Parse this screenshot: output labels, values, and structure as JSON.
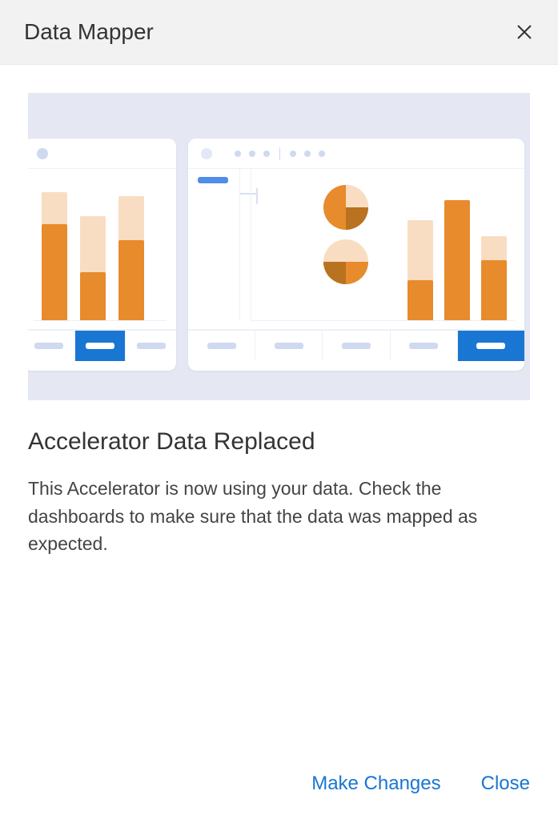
{
  "header": {
    "title": "Data Mapper"
  },
  "content": {
    "heading": "Accelerator Data Replaced",
    "body": "This Accelerator is now using your data. Check the dashboards to make sure that the data was mapped as expected."
  },
  "footer": {
    "make_changes": "Make Changes",
    "close": "Close"
  },
  "colors": {
    "accent": "#1976d2",
    "chart_primary": "#e78b2c",
    "chart_light": "#f9ddc2",
    "chart_dark": "#b97220",
    "illustration_bg": "#e5e8f3"
  }
}
